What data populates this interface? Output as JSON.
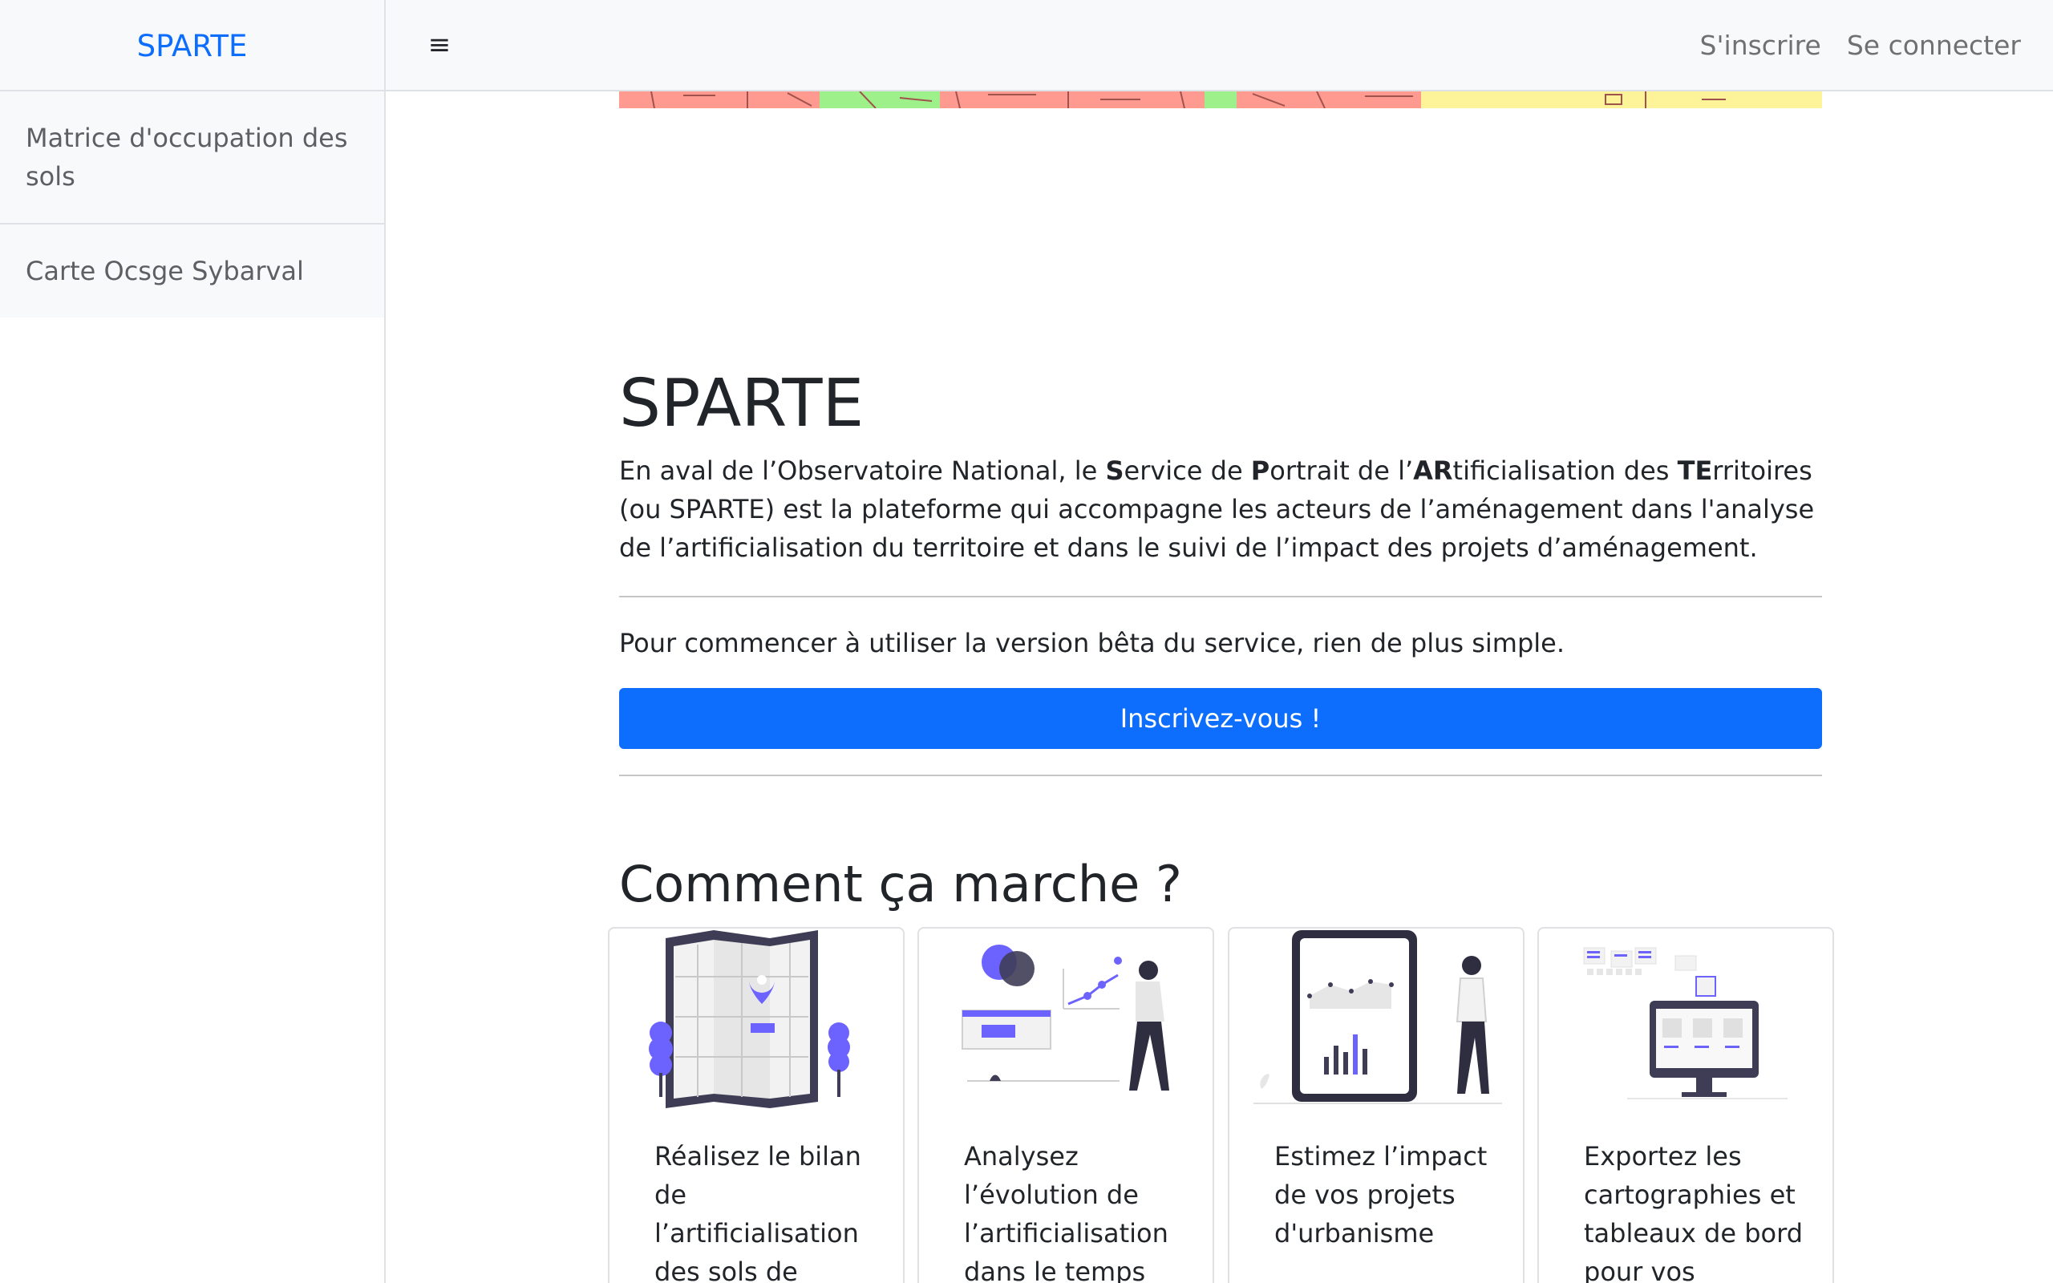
{
  "navbar": {
    "brand": "SPARTE",
    "menu_icon": "hamburger-menu-icon",
    "menu_glyph": "≡",
    "signup_label": "S'inscrire",
    "login_label": "Se connecter"
  },
  "sidebar": {
    "items": [
      {
        "label": "Matrice d'occupation des sols"
      },
      {
        "label": "Carte Ocsge Sybarval"
      }
    ]
  },
  "hero": {
    "title": "SPARTE",
    "lead": [
      {
        "t": "En aval de l’Observatoire National, le "
      },
      {
        "t": "S",
        "b": true
      },
      {
        "t": "ervice de "
      },
      {
        "t": "P",
        "b": true
      },
      {
        "t": "ortrait de l’"
      },
      {
        "t": "AR",
        "b": true
      },
      {
        "t": "tificialisation des "
      },
      {
        "t": "TE",
        "b": true
      },
      {
        "t": "rritoires (ou SPARTE) est la plateforme qui accompagne les acteurs de l’aménagement dans l'analyse de l’artificialisation du territoire et dans le suivi de l’impact des projets d’aménagement."
      }
    ],
    "start_text": "Pour commencer à utiliser la version bêta du service, rien de plus simple.",
    "cta_label": "Inscrivez-vous !"
  },
  "how": {
    "title": "Comment ça marche ?",
    "cards": [
      {
        "text": "Réalisez le bilan de l’artificialisation des sols de",
        "icon": "map-pin-illustration"
      },
      {
        "text": "Analysez l’évolution de l’artificialisation dans le temps",
        "icon": "analytics-person-illustration"
      },
      {
        "text": "Estimez l’impact de vos projets d'urbanisme",
        "icon": "tablet-chart-illustration"
      },
      {
        "text": "Exportez les cartographies et tableaux de bord pour vos",
        "icon": "monitor-export-illustration"
      }
    ]
  },
  "colors": {
    "brand": "#0d6efd",
    "accent_illustration": "#6c63ff",
    "banner_red": "#ff9a90",
    "banner_green": "#9ef08a",
    "banner_yellow": "#fdf49a"
  }
}
